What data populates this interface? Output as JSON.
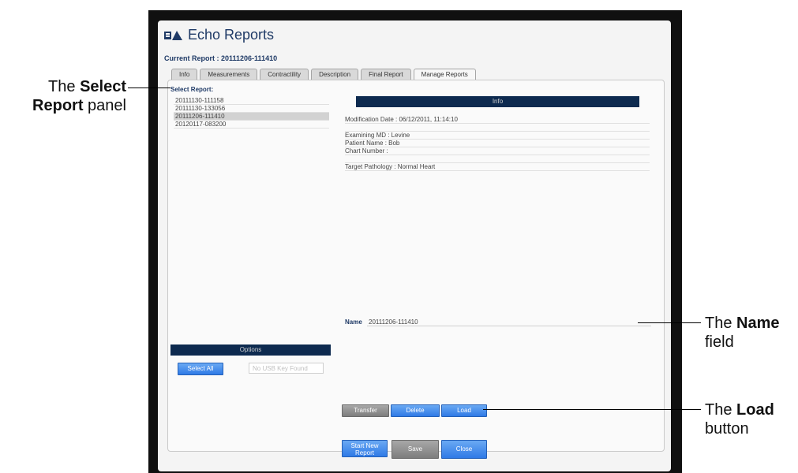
{
  "window": {
    "title": "Echo Reports",
    "current_report": "Current Report : 20111206-111410"
  },
  "tabs": [
    "Info",
    "Measurements",
    "Contractility",
    "Description",
    "Final Report",
    "Manage Reports"
  ],
  "select_report": {
    "label": "Select Report:",
    "items": [
      "20111130-111158",
      "20111130-133056",
      "20111206-111410",
      "20120117-083200"
    ],
    "selected_index": 2
  },
  "info": {
    "header": "Info",
    "modification": "Modification Date : 06/12/2011, 11:14:10",
    "examining_md": "Examining MD : Levine",
    "patient_name": "Patient Name : Bob",
    "chart_number": "Chart Number :",
    "target_pathology": "Target Pathology : Normal Heart"
  },
  "name_field": {
    "label": "Name",
    "value": "20111206-111410"
  },
  "options": {
    "header": "Options",
    "select_all": "Select All",
    "usb_placeholder": "No USB Key Found"
  },
  "actions": {
    "transfer": "Transfer",
    "delete": "Delete",
    "load": "Load"
  },
  "footer": {
    "start_new_1": "Start New",
    "start_new_2": "Report",
    "save": "Save",
    "close": "Close"
  },
  "annotations": {
    "select_panel_1": "The ",
    "select_panel_bold1": "Select",
    "select_panel_bold2": "Report",
    "select_panel_2": " panel",
    "name_1": "The ",
    "name_bold": "Name",
    "name_2": "field",
    "load_1": "The ",
    "load_bold": "Load",
    "load_2": "button"
  },
  "colors": {
    "accent": "#0d2a4f",
    "button_blue": "#2f7ae6",
    "button_gray": "#7d7d7d",
    "title": "#1f3a66"
  }
}
